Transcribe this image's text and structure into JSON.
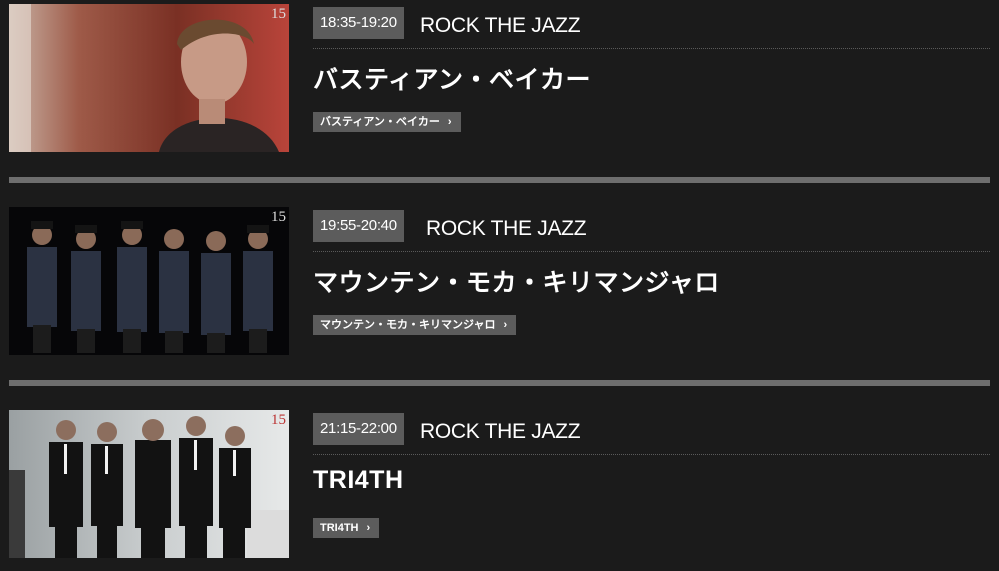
{
  "lineup": [
    {
      "time": "18:35-19:20",
      "stage": "ROCK THE JAZZ",
      "artist": "バスティアン・ベイカー",
      "link_label": "バスティアン・ベイカー",
      "badge_num": "15",
      "chevron_icon": "chevron-right-icon"
    },
    {
      "time": "19:55-20:40",
      "stage": "ROCK THE JAZZ",
      "artist": "マウンテン・モカ・キリマンジャロ",
      "link_label": "マウンテン・モカ・キリマンジャロ",
      "badge_num": "15",
      "chevron_icon": "chevron-right-icon"
    },
    {
      "time": "21:15-22:00",
      "stage": "ROCK THE JAZZ",
      "artist": "TRI4TH",
      "link_label": "TRI4TH",
      "badge_num": "15",
      "chevron_icon": "chevron-right-icon"
    }
  ],
  "colors": {
    "page_bg": "#1b1b1b",
    "badge_bg": "#5c5c5c",
    "divider": "#6e6e6e"
  }
}
